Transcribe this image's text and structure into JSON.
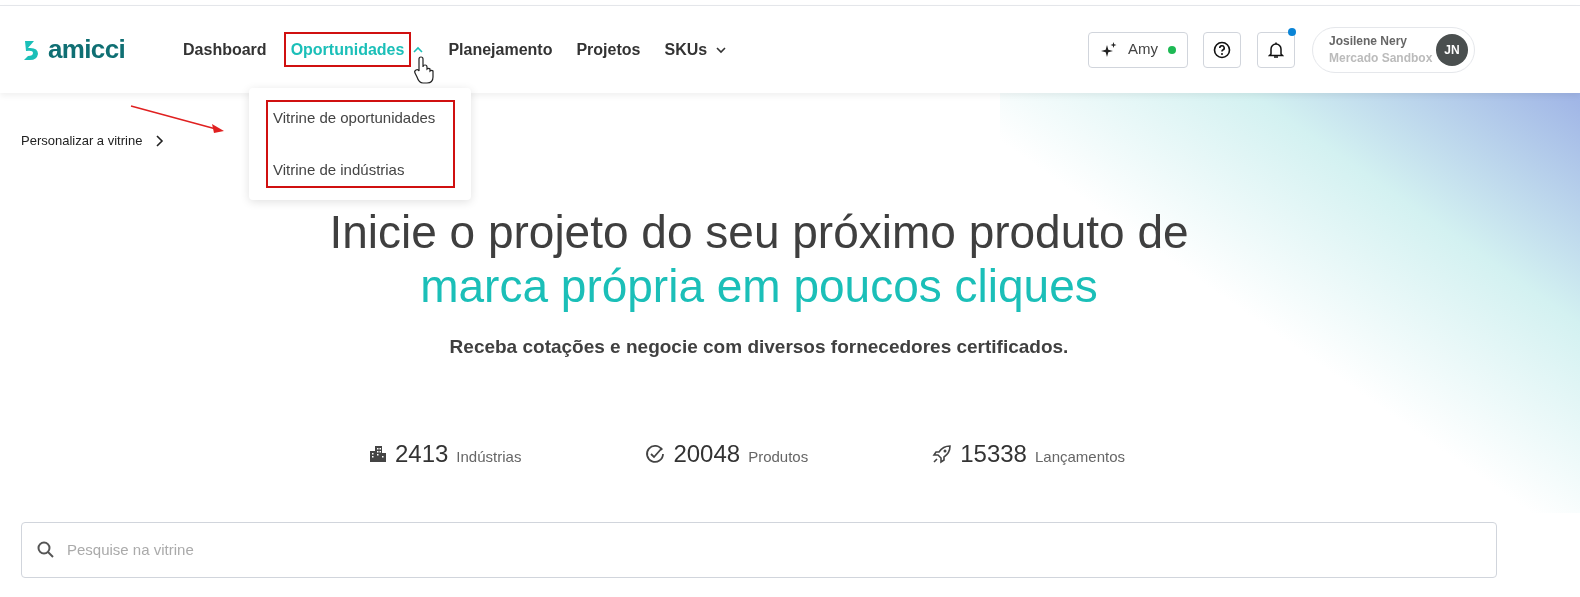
{
  "header": {
    "logo": "amicci",
    "nav": [
      {
        "label": "Dashboard",
        "selected": false,
        "kind": "link"
      },
      {
        "label": "Oportunidades",
        "selected": true,
        "kind": "dropdown",
        "expanded": true
      },
      {
        "label": "Planejamento",
        "selected": false,
        "kind": "link"
      },
      {
        "label": "Projetos",
        "selected": false,
        "kind": "link"
      },
      {
        "label": "SKUs",
        "selected": false,
        "kind": "dropdown",
        "expanded": false
      }
    ],
    "assistant": {
      "label": "Amy",
      "online": true
    },
    "notifications": {
      "unread": true
    },
    "user": {
      "name": "Josilene Nery",
      "org": "Mercado Sandbox",
      "initials": "JN"
    }
  },
  "dropdown": {
    "items": [
      "Vitrine de oportunidades",
      "Vitrine de indústrias"
    ]
  },
  "customize_link": "Personalizar a vitrine",
  "hero": {
    "title_line1": "Inicie o projeto do seu próximo produto de",
    "title_line2": "marca própria em poucos cliques",
    "subtitle": "Receba cotações e negocie com diversos fornecedores certificados."
  },
  "stats": [
    {
      "kind": "industries",
      "value": "2413",
      "label": "Indústrias"
    },
    {
      "kind": "products",
      "value": "20048",
      "label": "Produtos"
    },
    {
      "kind": "launches",
      "value": "15338",
      "label": "Lançamentos"
    }
  ],
  "search": {
    "placeholder": "Pesquise na vitrine"
  }
}
